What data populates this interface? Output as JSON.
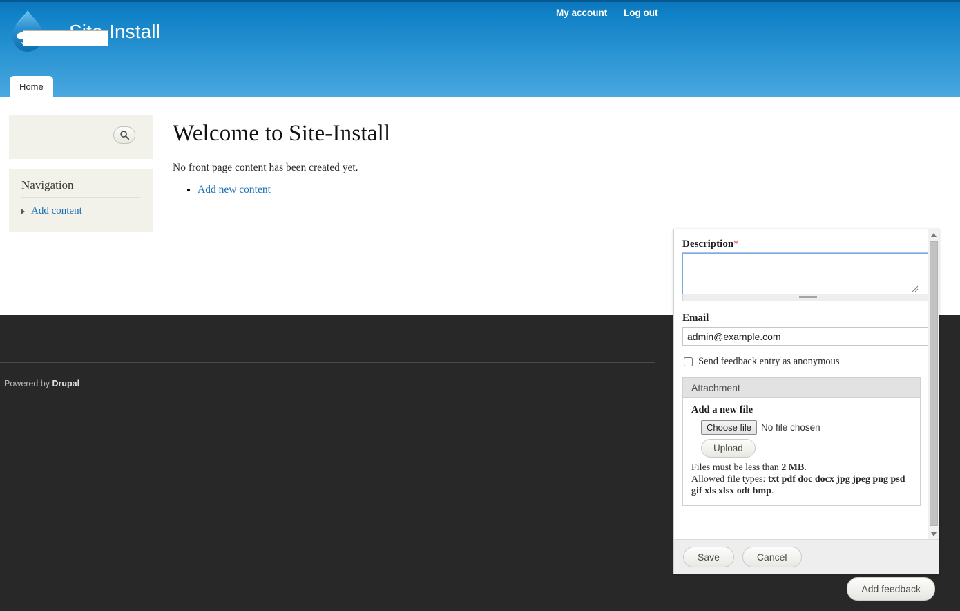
{
  "header": {
    "site_name": "Site-Install",
    "logo_icon": "drupal-droplet-logo",
    "user_links": [
      {
        "label": "My account"
      },
      {
        "label": "Log out"
      }
    ],
    "tabs": [
      {
        "label": "Home"
      }
    ]
  },
  "sidebar": {
    "search": {
      "value": "",
      "placeholder": "",
      "button_icon": "search-icon"
    },
    "navigation": {
      "title": "Navigation",
      "items": [
        {
          "label": "Add content"
        }
      ]
    }
  },
  "main": {
    "page_title": "Welcome to Site-Install",
    "empty_message": "No front page content has been created yet.",
    "links": [
      {
        "label": "Add new content"
      }
    ]
  },
  "footer": {
    "powered_prefix": "Powered by ",
    "powered_link": "Drupal",
    "add_feedback_label": "Add feedback"
  },
  "feedback_modal": {
    "description": {
      "label": "Description",
      "required_mark": "*",
      "value": "",
      "placeholder": ""
    },
    "email": {
      "label": "Email",
      "value": "admin@example.com",
      "placeholder": ""
    },
    "anonymous": {
      "label": "Send feedback entry as anonymous",
      "checked": false
    },
    "attachment": {
      "legend": "Attachment",
      "add_file_label": "Add a new file",
      "choose_file_label": "Choose file",
      "no_file_text": "No file chosen",
      "upload_label": "Upload",
      "size_note_prefix": "Files must be less than ",
      "size_note_value": "2 MB",
      "size_note_suffix": ".",
      "types_note_prefix": "Allowed file types: ",
      "types_note_value": "txt pdf doc docx jpg jpeg png psd gif xls xlsx odt bmp",
      "types_note_suffix": "."
    },
    "actions": {
      "save_label": "Save",
      "cancel_label": "Cancel"
    },
    "scrollbar": {
      "up_icon": "triangle-up-icon",
      "down_icon": "triangle-down-icon"
    }
  },
  "colors": {
    "header_blue_top": "#0d76bb",
    "header_blue_bottom": "#4aa8e0",
    "link_blue": "#1a6fb5",
    "footer_dark": "#282828",
    "block_beige": "#f2f1ea",
    "required_red": "#e4584f"
  }
}
